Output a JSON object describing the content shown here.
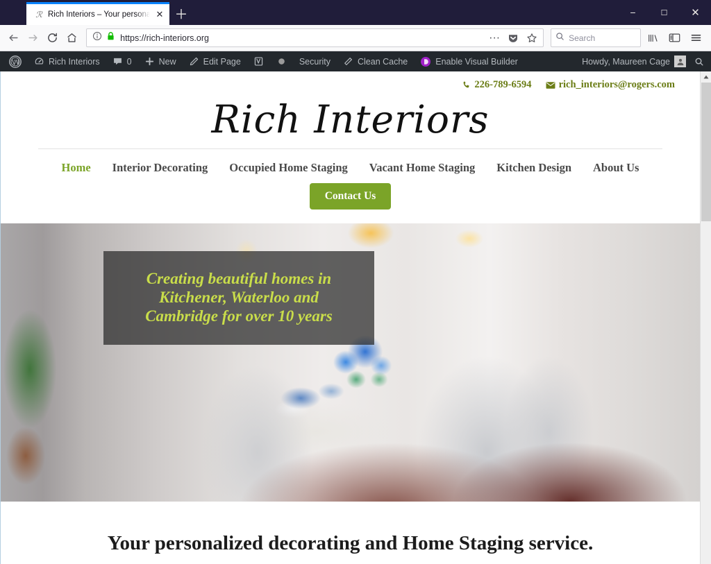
{
  "browser": {
    "tab": {
      "title": "Rich Interiors – Your personalized",
      "favicon_icon": "script-r-favicon",
      "close_icon": "✕"
    },
    "new_tab_icon": "＋",
    "window_controls": {
      "minimize": "−",
      "maximize": "☐",
      "close": "✕"
    },
    "toolbar": {
      "back_icon": "←",
      "forward_icon": "→",
      "reload_icon": "⟳",
      "home_icon": "⌂",
      "identity_info_icon": "ⓘ",
      "lock_icon": "lock",
      "url": "https://rich-interiors.org",
      "page_actions_icon": "···",
      "pocket_icon": "pocket-shield",
      "bookmark_star_icon": "☆",
      "search_placeholder": "Search",
      "search_icon": "⚲",
      "library_icon": "library",
      "sidebar_icon": "sidebar",
      "menu_icon": "☰"
    }
  },
  "adminbar": {
    "wp_logo_icon": "wordpress-logo-icon",
    "items": [
      {
        "label": "Rich Interiors",
        "icon": "dashboard-icon"
      },
      {
        "label": "0",
        "icon": "comment-bubble-icon"
      },
      {
        "label": "New",
        "icon": "plus-icon"
      },
      {
        "label": "Edit Page",
        "icon": "pencil-icon"
      },
      {
        "label": "",
        "icon": "yoast-seo-icon"
      },
      {
        "label": "",
        "icon": "status-dot-icon"
      },
      {
        "label": "Security",
        "icon": ""
      },
      {
        "label": "Clean Cache",
        "icon": "eraser-icon"
      },
      {
        "label": "Enable Visual Builder",
        "icon": "divi-icon"
      }
    ],
    "howdy": "Howdy, Maureen Cage",
    "avatar_icon": "user-avatar-icon",
    "search_icon": "search-icon"
  },
  "site": {
    "contact": {
      "phone": "226-789-6594",
      "phone_icon": "phone-icon",
      "email": "rich_interiors@rogers.com",
      "email_icon": "envelope-icon"
    },
    "logo_text": "Rich Interiors",
    "nav": [
      {
        "label": "Home",
        "active": true
      },
      {
        "label": "Interior Decorating",
        "active": false
      },
      {
        "label": "Occupied Home Staging",
        "active": false
      },
      {
        "label": "Vacant Home Staging",
        "active": false
      },
      {
        "label": "Kitchen Design",
        "active": false
      },
      {
        "label": "About Us",
        "active": false
      }
    ],
    "cta_label": "Contact Us",
    "hero": {
      "line1": "Creating beautiful homes in",
      "line2": "Kitchener, Waterloo and",
      "line3": "Cambridge for over 10 years",
      "image_alt": "dining-room-photo"
    },
    "tagline": "Your personalized decorating and Home Staging service."
  },
  "colors": {
    "accent_green": "#7ba428",
    "contact_olive": "#6b7d16",
    "hero_text": "#c9dd4a",
    "adminbar_bg": "#23282d",
    "titlebar_bg": "#201d3a",
    "tab_accent": "#0a84ff"
  },
  "scrollbar": {
    "up_arrow_icon": "▲"
  }
}
